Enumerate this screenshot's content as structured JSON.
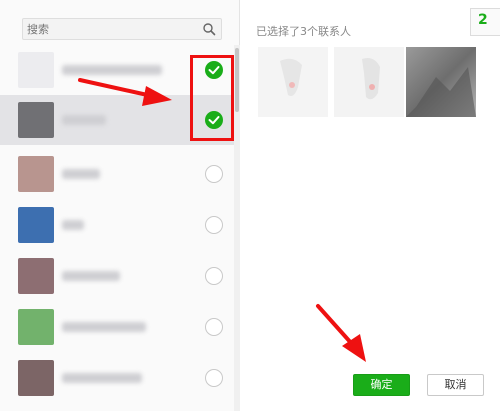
{
  "search": {
    "placeholder": "搜索"
  },
  "contacts": [
    {
      "selected": true,
      "avatar_color": "#e9e9ec"
    },
    {
      "selected": true,
      "avatar_color": "#6f6f72"
    },
    {
      "selected": false,
      "avatar_color": "#b08d8a"
    },
    {
      "selected": false,
      "avatar_color": "#3b6fb3"
    },
    {
      "selected": false,
      "avatar_color": "#8c6b70"
    },
    {
      "selected": false,
      "avatar_color": "#6fb06a"
    },
    {
      "selected": false,
      "avatar_color": "#7b6364"
    }
  ],
  "right": {
    "selected_title": "已选择了3个联系人",
    "corner_label": "2"
  },
  "buttons": {
    "ok_label": "确定",
    "cancel_label": "取消"
  },
  "colors": {
    "accent_green": "#1aad19",
    "annotation_red": "#ee1111"
  }
}
